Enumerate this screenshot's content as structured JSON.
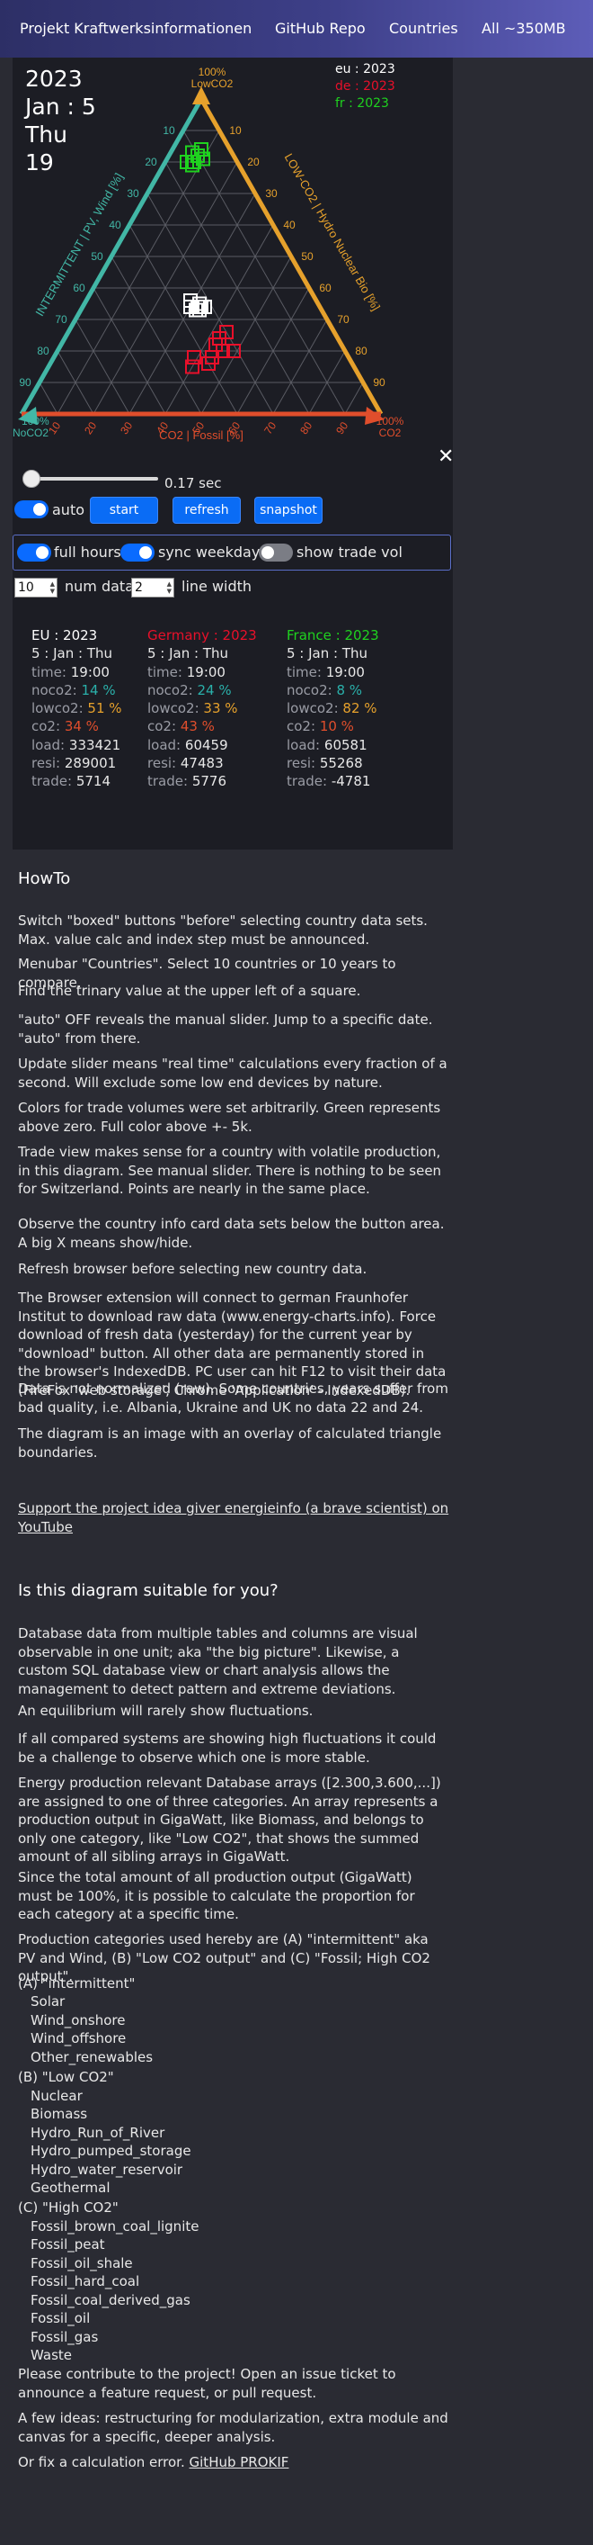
{
  "nav": {
    "brand": "Projekt Kraftwerksinformationen",
    "links": [
      "GitHub Repo",
      "Countries",
      "All ~350MB"
    ]
  },
  "date": {
    "year": "2023",
    "monthday": "Jan : 5",
    "weekday": "Thu",
    "hour": "19"
  },
  "legend": [
    {
      "label": "eu : 2023",
      "color": "#ffffff"
    },
    {
      "label": "de : 2023",
      "color": "#e8102a"
    },
    {
      "label": "fr : 2023",
      "color": "#1fd21f"
    }
  ],
  "ternary": {
    "top_corner": [
      "100%",
      "LowCO2"
    ],
    "left_corner": [
      "100%",
      "NoCO2"
    ],
    "right_corner": [
      "100%",
      "CO2"
    ],
    "left_axis": "INTERMITTENT | PV, Wind [%]",
    "right_axis": "LOW-CO2 | Hydro Nuclear Bio [%]",
    "bottom_axis": "CO2 | Fossil [%]",
    "ticks": [
      "10",
      "20",
      "30",
      "40",
      "50",
      "60",
      "70",
      "80",
      "90"
    ],
    "colors": {
      "left": "#42b7a6",
      "right": "#e6a12c",
      "bottom": "#e04e2c"
    },
    "points": {
      "eu": {
        "color": "#ffffff",
        "coords": [
          [
            34,
            33,
            33
          ],
          [
            33,
            34,
            33
          ],
          [
            35,
            33,
            32
          ],
          [
            33,
            35,
            32
          ],
          [
            34,
            34,
            32
          ],
          [
            32,
            34,
            34
          ],
          [
            36,
            34,
            30
          ],
          [
            35,
            36,
            29
          ]
        ]
      },
      "de": {
        "color": "#e8102a",
        "coords": [
          [
            33,
            24,
            43
          ],
          [
            35,
            22,
            43
          ],
          [
            31,
            20,
            49
          ],
          [
            34,
            20,
            46
          ],
          [
            38,
            18,
            44
          ],
          [
            40,
            16,
            44
          ],
          [
            43,
            18,
            39
          ],
          [
            45,
            15,
            40
          ],
          [
            30,
            26,
            44
          ]
        ]
      },
      "fr": {
        "color": "#1fd21f",
        "coords": [
          [
            10,
            82,
            8
          ],
          [
            12,
            80,
            8
          ],
          [
            9,
            81,
            10
          ],
          [
            11,
            83,
            6
          ],
          [
            13,
            79,
            8
          ],
          [
            8,
            84,
            8
          ],
          [
            14,
            80,
            6
          ]
        ]
      }
    }
  },
  "close": "✕",
  "slider": {
    "value": "0.17 sec",
    "fraction": 0.05
  },
  "controls": {
    "auto": "auto",
    "start": "start",
    "refresh": "refresh",
    "snapshot": "snapshot",
    "full_hours": "full hours",
    "sync_weekday": "sync weekday",
    "show_trade_vol": "show trade vol",
    "num_data_value": "10",
    "num_data": "num data",
    "line_width_value": "2",
    "line_width": "line width"
  },
  "cards": [
    {
      "title": "EU : 2023",
      "title_color": "#ffffff",
      "accent": "#2ab0aa",
      "pct2": "#2ab0aa",
      "pct3": "#e8102a",
      "day": "5 : Jan : Thu",
      "time": "19:00",
      "noco2": "14 %",
      "lowco2": "51 %",
      "co2": "34 %",
      "load": "333421",
      "resi": "289001",
      "trade": "5714"
    },
    {
      "title": "Germany : 2023",
      "title_color": "#e8102a",
      "accent": "#2ab0aa",
      "day": "5 : Jan : Thu",
      "time": "19:00",
      "noco2": "24 %",
      "lowco2": "33 %",
      "co2": "43 %",
      "load": "60459",
      "resi": "47483",
      "trade": "5776"
    },
    {
      "title": "France : 2023",
      "title_color": "#1fd21f",
      "accent": "#2ab0aa",
      "day": "5 : Jan : Thu",
      "time": "19:00",
      "noco2": "8 %",
      "lowco2": "82 %",
      "co2": "10 %",
      "load": "60581",
      "resi": "55268",
      "trade": "-4781"
    }
  ],
  "card_keys": {
    "time": "time:",
    "noco2": "noco2:",
    "lowco2": "lowco2:",
    "co2": "co2:",
    "load": "load:",
    "resi": "resi:",
    "trade": "trade:"
  },
  "howto": {
    "title": "HowTo",
    "paragraphs": [
      "Switch \"boxed\" buttons \"before\" selecting country data sets. Max. value calc and index step must be announced.",
      "Menubar \"Countries\". Select 10 countries or 10 years to compare.",
      "Find the trinary value at the upper left of a square.",
      "\"auto\" OFF reveals the manual slider. Jump to a specific date. \"auto\" from there.",
      "Update slider means \"real time\" calculations every fraction of a second. Will exclude some low end devices by nature.",
      "Colors for trade volumes were set arbitrarily. Green represents above zero. Full color above +- 5k.",
      "Trade view makes sense for a country with volatile production, in this diagram. See manual slider. There is nothing to be seen for Switzerland. Points are nearly in the same place.",
      "Observe the country info card data sets below the button area. A big X means show/hide.",
      "Refresh browser before selecting new country data.",
      "The Browser extension will connect to german Fraunhofer Institut to download raw data (www.energy-charts.info). Force download of fresh data (yesterday) for the current year by \"download\" button. All other data are permanently stored in the browser's IndexedDB. PC user can hit F12 to visit their data (FireFox 'web storage', Chrome 'Application' - IndexedDB).",
      "Data is not normalized (raw). Some countries, years suffer from bad quality, i.e. Albania, Ukraine and UK no data 22 and 24.",
      "The diagram is an image with an overlay of calculated triangle boundaries."
    ],
    "support_link": "Support the project idea giver energieinfo (a brave scientist) on YouTube"
  },
  "suitable": {
    "title": "Is this diagram suitable for you?",
    "paragraphs": [
      "Database data from multiple tables and columns are visual observable in one unit; aka \"the big picture\". Likewise, a custom SQL database view or chart analysis allows the management to detect pattern and extreme deviations.",
      "An equilibrium will rarely show fluctuations.",
      "If all compared systems are showing high fluctuations it could be a challenge to observe which one is more stable.",
      "Energy production relevant Database arrays ([2.300,3.600,...]) are assigned to one of three categories. An array represents a production output in GigaWatt, like Biomass, and belongs to only one category, like \"Low CO2\", that shows the summed amount of all sibling arrays in GigaWatt.",
      "Since the total amount of all production output (GigaWatt) must be 100%, it is possible to calculate the proportion for each category at a specific time.",
      "Production categories used hereby are (A) \"intermittent\" aka PV and Wind, (B) \"Low CO2 output\" and (C) \"Fossil; High CO2 output\"."
    ],
    "cat_a": "(A) \"intermittent\"",
    "list_a": [
      "Solar",
      "Wind_onshore",
      "Wind_offshore",
      "Other_renewables"
    ],
    "cat_b": "(B) \"Low CO2\"",
    "list_b": [
      "Nuclear",
      "Biomass",
      "Hydro_Run_of_River",
      "Hydro_pumped_storage",
      "Hydro_water_reservoir",
      "Geothermal"
    ],
    "cat_c": "(C) \"High CO2\"",
    "list_c": [
      "Fossil_brown_coal_lignite",
      "Fossil_peat",
      "Fossil_oil_shale",
      "Fossil_hard_coal",
      "Fossil_coal_derived_gas",
      "Fossil_oil",
      "Fossil_gas",
      "Waste"
    ],
    "contribute": "Please contribute to the project! Open an issue ticket to announce a feature request, or pull request.",
    "ideas": "A few ideas: restructuring for modularization, extra module and canvas for a specific, deeper analysis.",
    "fix_prefix": "Or fix a calculation error.",
    "fix_link": "GitHub PROKIF"
  }
}
